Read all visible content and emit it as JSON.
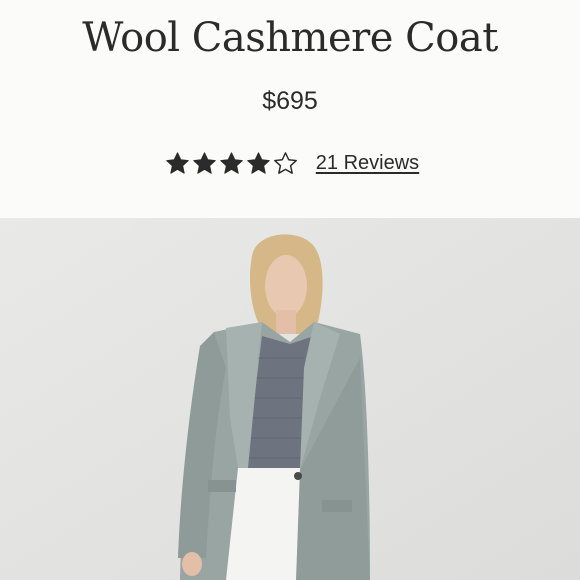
{
  "product": {
    "title": "Wool Cashmere Coat",
    "price": "$695",
    "rating": {
      "value": 4,
      "max": 5,
      "filled_icon": "star-filled-icon",
      "empty_icon": "star-outline-icon",
      "star_color": "#2b2b2b"
    },
    "reviews_label": "21 Reviews"
  },
  "image": {
    "description": "product-photo-model-in-gray-wool-coat",
    "colors": {
      "backdrop": "#e6e6e4",
      "coat": "#98a5a3",
      "sweater": "#6f7481",
      "jeans": "#f3f3f1",
      "hair": "#d8b98a",
      "skin": "#e8c7b0"
    }
  }
}
